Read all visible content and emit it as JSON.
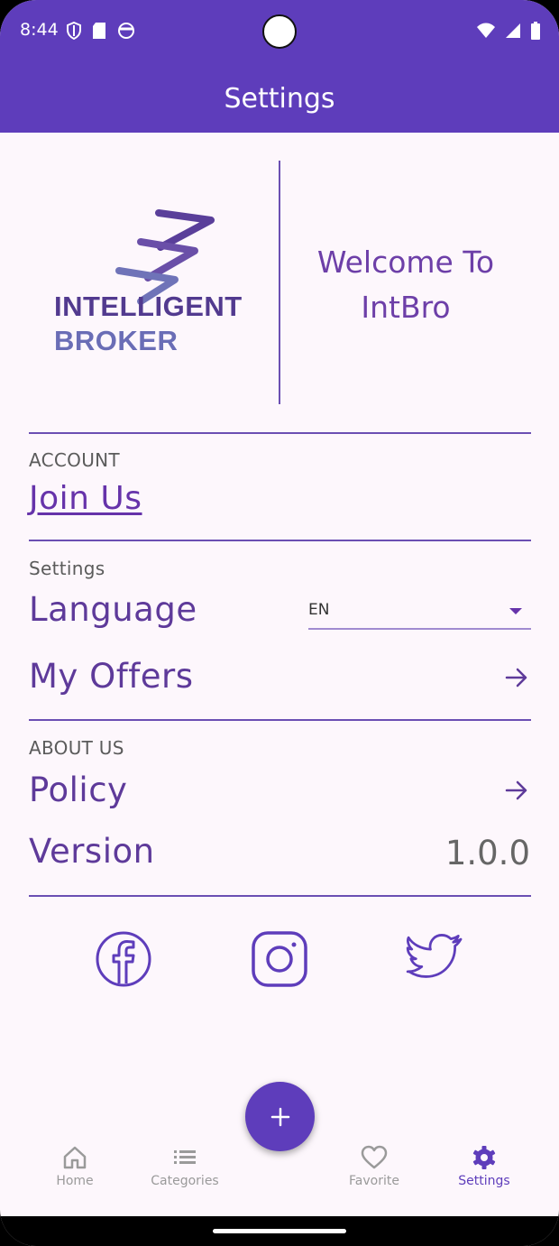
{
  "status_bar": {
    "time": "8:44"
  },
  "app_bar": {
    "title": "Settings"
  },
  "brand": {
    "word1": "INTELLIGENT",
    "word2": "BROKER",
    "welcome_line1": "Welcome To",
    "welcome_line2": "IntBro"
  },
  "account": {
    "section_label": "ACCOUNT",
    "join_label": "Join Us"
  },
  "settings": {
    "section_label": "Settings",
    "language_label": "Language",
    "language_value": "EN",
    "my_offers_label": "My Offers"
  },
  "about": {
    "section_label": "ABOUT US",
    "policy_label": "Policy",
    "version_label": "Version",
    "version_value": "1.0.0"
  },
  "social": {
    "icons": [
      "facebook-icon",
      "instagram-icon",
      "twitter-icon"
    ]
  },
  "bottom_nav": {
    "items": [
      {
        "label": "Home",
        "icon": "home-icon",
        "active": false
      },
      {
        "label": "Categories",
        "icon": "list-icon",
        "active": false
      },
      {
        "label": "Favorite",
        "icon": "heart-icon",
        "active": false
      },
      {
        "label": "Settings",
        "icon": "gear-icon",
        "active": true
      }
    ]
  },
  "colors": {
    "primary": "#5e3dbb",
    "accent_text": "#6633aa",
    "background": "#fdf7fc",
    "inactive": "#9a9a9a"
  }
}
